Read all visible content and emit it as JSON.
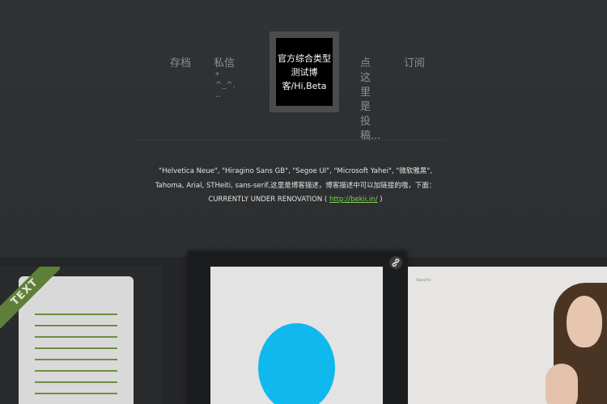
{
  "nav": {
    "left": [
      {
        "label": "存档"
      },
      {
        "label": "私信",
        "extra": "*\n^_^.\n.."
      }
    ],
    "right": [
      {
        "label": "点这里是投稿..."
      },
      {
        "label": "订阅"
      }
    ]
  },
  "logo": {
    "text": "官方综合类型\n测试博\n客/Hi,Beta"
  },
  "description": {
    "body": "\"Helvetica Neue\", \"Hiragino Sans GB\", \"Segoe UI\", \"Microsoft Yahei\", \"微软雅黑\", Tahoma, Arial, STHeiti, sans-serif,这里是博客描述，博客描述中可以加链接的哦，下面：",
    "status_prefix": "CURRENTLY UNDER RENOVATION ( ",
    "link_text": "http://bekii.in/",
    "status_suffix": " )"
  },
  "gallery": {
    "text_card_label": "TEXT",
    "photo_caption": "Xaocho"
  },
  "colors": {
    "background": "#2f3133",
    "link": "#7fd15a",
    "accent_circle": "#0fb9ee",
    "ribbon": "#5e7f3a"
  }
}
